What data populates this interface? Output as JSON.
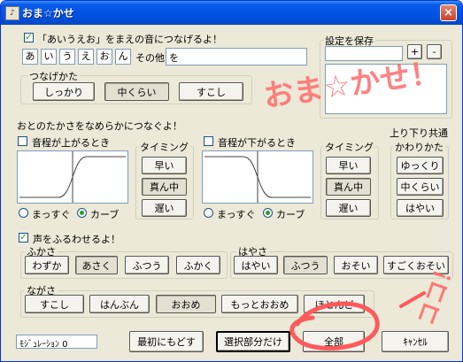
{
  "window": {
    "title": "おま☆かせ",
    "close": "×"
  },
  "connect": {
    "checkbox_label": "「あいうえお」をまえの音につなげるよ！",
    "checked": true,
    "vowels": [
      "あ",
      "い",
      "う",
      "え",
      "お",
      "ん"
    ],
    "other_label": "その他",
    "other_value": "を"
  },
  "tsunagekata": {
    "label": "つなげかた",
    "buttons": [
      "しっかり",
      "中くらい",
      "すこし"
    ]
  },
  "settings": {
    "label": "設定を保存",
    "add": "+",
    "remove": "-"
  },
  "smooth_label": "おとのたかさをなめらかにつなぐよ！",
  "rise": {
    "checkbox_label": "音程が上がるとき",
    "radio_straight": "まっすぐ",
    "radio_curve": "カーブ"
  },
  "fall": {
    "checkbox_label": "音程が下がるとき",
    "radio_straight": "まっすぐ",
    "radio_curve": "カーブ"
  },
  "timing1": {
    "label": "タイミング",
    "buttons": [
      "早い",
      "真ん中",
      "遅い"
    ]
  },
  "timing2": {
    "label": "タイミング",
    "buttons": [
      "早い",
      "真ん中",
      "遅い"
    ]
  },
  "updown": {
    "label_line1": "上り下り共通",
    "label_line2": "かわりかた",
    "buttons": [
      "ゆっくり",
      "中くらい",
      "はやい"
    ]
  },
  "vibrato": {
    "checkbox_label": "声をふるわせるよ！",
    "checked": true
  },
  "depth": {
    "label": "ふかさ",
    "buttons": [
      "わずか",
      "あさく",
      "ふつう",
      "ふかく"
    ]
  },
  "speed": {
    "label": "はやさ",
    "buttons": [
      "はやい",
      "ふつう",
      "おそい",
      "すごくおそい"
    ]
  },
  "length": {
    "label": "ながさ",
    "buttons": [
      "すこし",
      "はんぶん",
      "おおめ",
      "もっとおおめ",
      "ほとんど"
    ]
  },
  "bottom": {
    "status": "ﾓｼﾞｭﾚｰｼｮﾝ 0",
    "reset": "最初にもどす",
    "selection_only": "選択部分だけ",
    "all": "全部",
    "cancel": "ｷｬﾝｾﾙ"
  },
  "annotations": {
    "omakase": "おま☆かせ！",
    "koko": "ココ！"
  },
  "colors": {
    "accent": "#ff5a5a",
    "title_bar": "#0054e3"
  }
}
